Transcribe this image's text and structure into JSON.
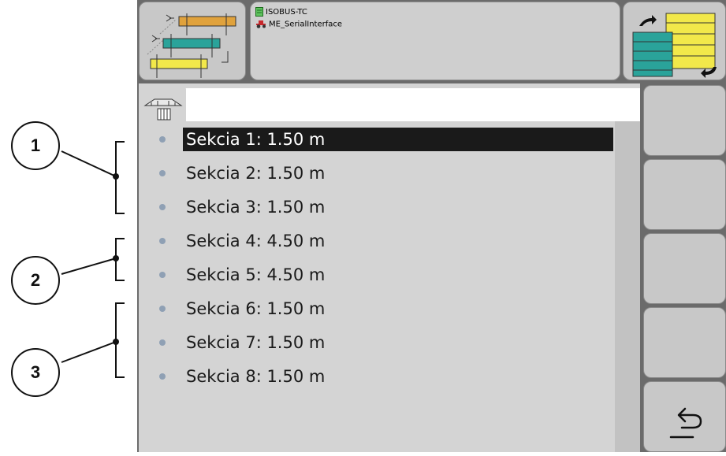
{
  "header": {
    "line1": "ISOBUS-TC",
    "line2": "ME_SerialInterface"
  },
  "callouts": [
    {
      "number": "1"
    },
    {
      "number": "2"
    },
    {
      "number": "3"
    }
  ],
  "sections": [
    {
      "label": "Sekcia 1: 1.50 m",
      "selected": true
    },
    {
      "label": "Sekcia 2: 1.50 m"
    },
    {
      "label": "Sekcia 3: 1.50 m"
    },
    {
      "label": "Sekcia 4: 4.50 m"
    },
    {
      "label": "Sekcia 5: 4.50 m"
    },
    {
      "label": "Sekcia 6: 1.50 m"
    },
    {
      "label": "Sekcia 7: 1.50 m"
    },
    {
      "label": "Sekcia 8: 1.50 m"
    }
  ],
  "icons": {
    "left_top": "machine-layout-swap-icon",
    "right_top": "map-layout-swap-icon",
    "tab": "boom-sprayer-icon",
    "line1": "document-icon",
    "line2": "tractor-icon",
    "back": "back-arrow-icon"
  },
  "colors": {
    "selection_bg": "#1a1a1a",
    "selection_fg": "#ffffff",
    "bullet": "#8fa0b4",
    "accent_yellow": "#f2e84a",
    "accent_teal": "#2aa39a",
    "accent_orange": "#e0a23c"
  }
}
